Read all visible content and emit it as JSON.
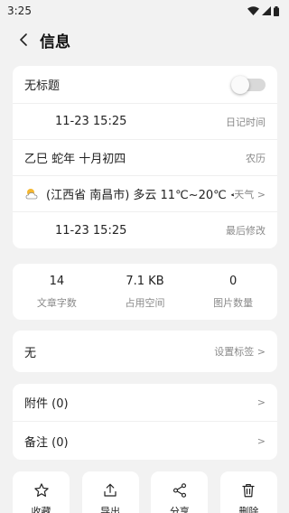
{
  "status_bar": {
    "time": "3:25"
  },
  "header": {
    "title": "信息"
  },
  "info_card": {
    "title_label": "无标题",
    "diary_time": {
      "value": "11-23 15:25",
      "label": "日记时间"
    },
    "lunar": {
      "value": "乙巳 蛇年 十月初四",
      "label": "农历"
    },
    "weather": {
      "value": "(江西省 南昌市) 多云 11℃~20℃ <3",
      "label": "天气 >"
    },
    "modified": {
      "value": "11-23 15:25",
      "label": "最后修改"
    }
  },
  "stats": [
    {
      "value": "14",
      "label": "文章字数"
    },
    {
      "value": "7.1 KB",
      "label": "占用空间"
    },
    {
      "value": "0",
      "label": "图片数量"
    }
  ],
  "tags": {
    "value": "无",
    "action": "设置标签 >"
  },
  "extras": {
    "attachments": {
      "label": "附件 (0)",
      "chevron": ">"
    },
    "notes": {
      "label": "备注 (0)",
      "chevron": ">"
    }
  },
  "actions": [
    {
      "label": "收藏",
      "icon": "star-icon"
    },
    {
      "label": "导出",
      "icon": "upload-icon"
    },
    {
      "label": "分享",
      "icon": "share-icon"
    },
    {
      "label": "删除",
      "icon": "trash-icon"
    }
  ]
}
